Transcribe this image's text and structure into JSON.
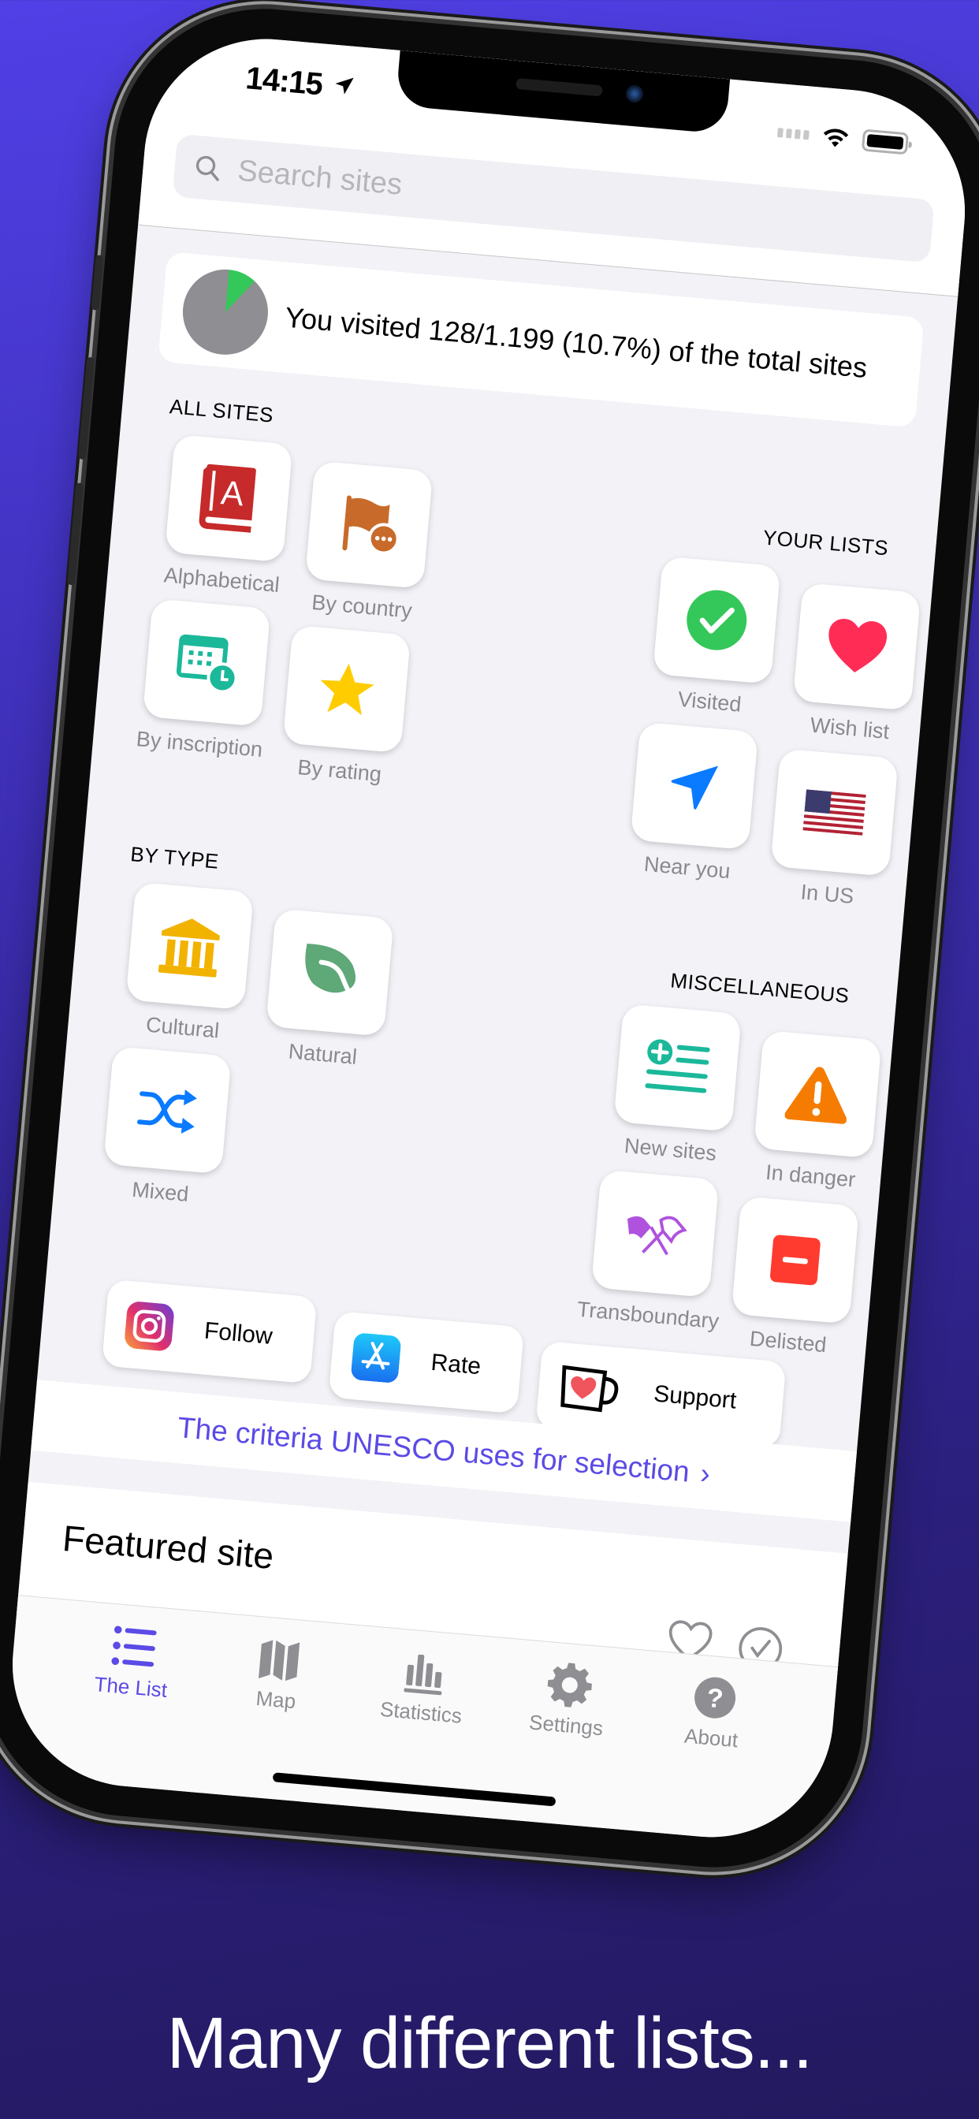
{
  "status_bar": {
    "time": "14:15"
  },
  "search": {
    "placeholder": "Search sites"
  },
  "progress": {
    "visited": 128,
    "total": 1199,
    "fraction": 0.107,
    "text": "You visited 128/1.199 (10.7%) of the total sites"
  },
  "sections": {
    "all_sites": {
      "label": "ALL SITES",
      "items": [
        {
          "label": "Alphabetical",
          "icon": "alphabetical-book-icon",
          "color": "#c62a2a"
        },
        {
          "label": "By country",
          "icon": "flag-more-icon",
          "color": "#c86b2a"
        },
        {
          "label": "By inscription",
          "icon": "calendar-clock-icon",
          "color": "#1bb89a"
        },
        {
          "label": "By rating",
          "icon": "star-icon",
          "color": "#ffcc00"
        }
      ]
    },
    "your_lists": {
      "label": "YOUR LISTS",
      "items": [
        {
          "label": "Visited",
          "icon": "checkmark-circle-icon",
          "color": "#34c759"
        },
        {
          "label": "Wish list",
          "icon": "heart-icon",
          "color": "#ff2d55"
        },
        {
          "label": "Near you",
          "icon": "location-arrow-icon",
          "color": "#0a7aff"
        },
        {
          "label": "In US",
          "icon": "us-flag-icon",
          "color": "#b22234"
        }
      ]
    },
    "by_type": {
      "label": "BY TYPE",
      "items": [
        {
          "label": "Cultural",
          "icon": "temple-icon",
          "color": "#f2b200"
        },
        {
          "label": "Natural",
          "icon": "leaf-icon",
          "color": "#5fa878"
        },
        {
          "label": "Mixed",
          "icon": "shuffle-icon",
          "color": "#0a7aff"
        }
      ]
    },
    "miscellaneous": {
      "label": "MISCELLANEOUS",
      "items": [
        {
          "label": "New sites",
          "icon": "add-list-icon",
          "color": "#1bb89a"
        },
        {
          "label": "In danger",
          "icon": "warning-triangle-icon",
          "color": "#f57c00"
        },
        {
          "label": "Transboundary",
          "icon": "crossed-flags-icon",
          "color": "#af52de"
        },
        {
          "label": "Delisted",
          "icon": "minus-square-icon",
          "color": "#ff3b30"
        }
      ]
    }
  },
  "social": [
    {
      "label": "Follow",
      "icon": "instagram-icon"
    },
    {
      "label": "Rate",
      "icon": "app-store-icon"
    },
    {
      "label": "Support",
      "icon": "coffee-mug-heart-icon"
    }
  ],
  "criteria_link": {
    "label": "The criteria UNESCO uses for selection",
    "chevron": "›"
  },
  "featured": {
    "title": "Featured site"
  },
  "tabs": [
    {
      "label": "The List",
      "icon": "list-icon",
      "active": true
    },
    {
      "label": "Map",
      "icon": "map-icon",
      "active": false
    },
    {
      "label": "Statistics",
      "icon": "bar-chart-icon",
      "active": false
    },
    {
      "label": "Settings",
      "icon": "gear-icon",
      "active": false
    },
    {
      "label": "About",
      "icon": "question-circle-icon",
      "active": false
    }
  ],
  "colors": {
    "accent": "#5b4ae6",
    "pie_visited": "#34c759",
    "pie_rest": "#8e8e93",
    "inactive_tab": "#8e8e93"
  },
  "caption": "Many different lists..."
}
